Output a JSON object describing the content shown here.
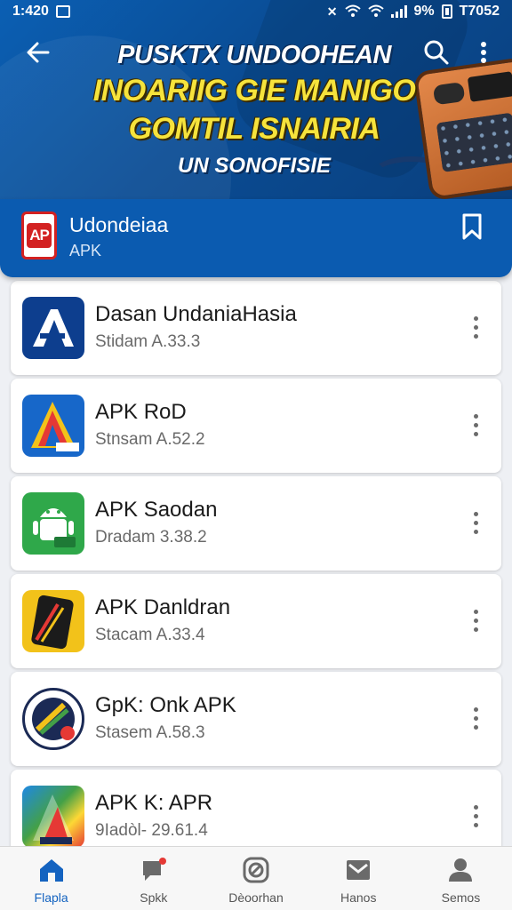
{
  "status_bar": {
    "time": "1:420",
    "right_text": "9%",
    "right_extra": "T7052"
  },
  "hero": {
    "line1": "PUSKTX UNDOOHEAN",
    "line2": "INOARIIG GIE MANIGO",
    "line3": "GOMTIL ISNAIRIA",
    "line4": "UN SONOFISIE"
  },
  "app_header": {
    "name": "Udondeiaa",
    "subtitle": "APK",
    "logo_text": "AP"
  },
  "apps": [
    {
      "title": "Dasan UndaniaHasia",
      "version": "Stidam A.33.3",
      "icon": "a-logo-icon"
    },
    {
      "title": "APK RoD",
      "version": "Stnsam A.52.2",
      "icon": "compass-a-icon"
    },
    {
      "title": "APK Saodan",
      "version": "Dradam 3.38.2",
      "icon": "android-robot-icon"
    },
    {
      "title": "APK Danldran",
      "version": "Stacam A.33.4",
      "icon": "phone-icon"
    },
    {
      "title": "GpK: Onk APK",
      "version": "Stasem A.58.3",
      "icon": "badge-icon"
    },
    {
      "title": "APK K: APR",
      "version": "9Iadòl- 29.61.4",
      "icon": "color-a-icon"
    }
  ],
  "bottom_nav": [
    {
      "label": "Flapla",
      "icon": "home-icon"
    },
    {
      "label": "Spkk",
      "icon": "chat-icon"
    },
    {
      "label": "Dèoorhan",
      "icon": "block-icon"
    },
    {
      "label": "Hanos",
      "icon": "mail-icon"
    },
    {
      "label": "Semos",
      "icon": "person-icon"
    }
  ],
  "colors": {
    "primary": "#0b5bb0",
    "accent_yellow": "#f6e33c",
    "active_nav": "#1463c0"
  }
}
